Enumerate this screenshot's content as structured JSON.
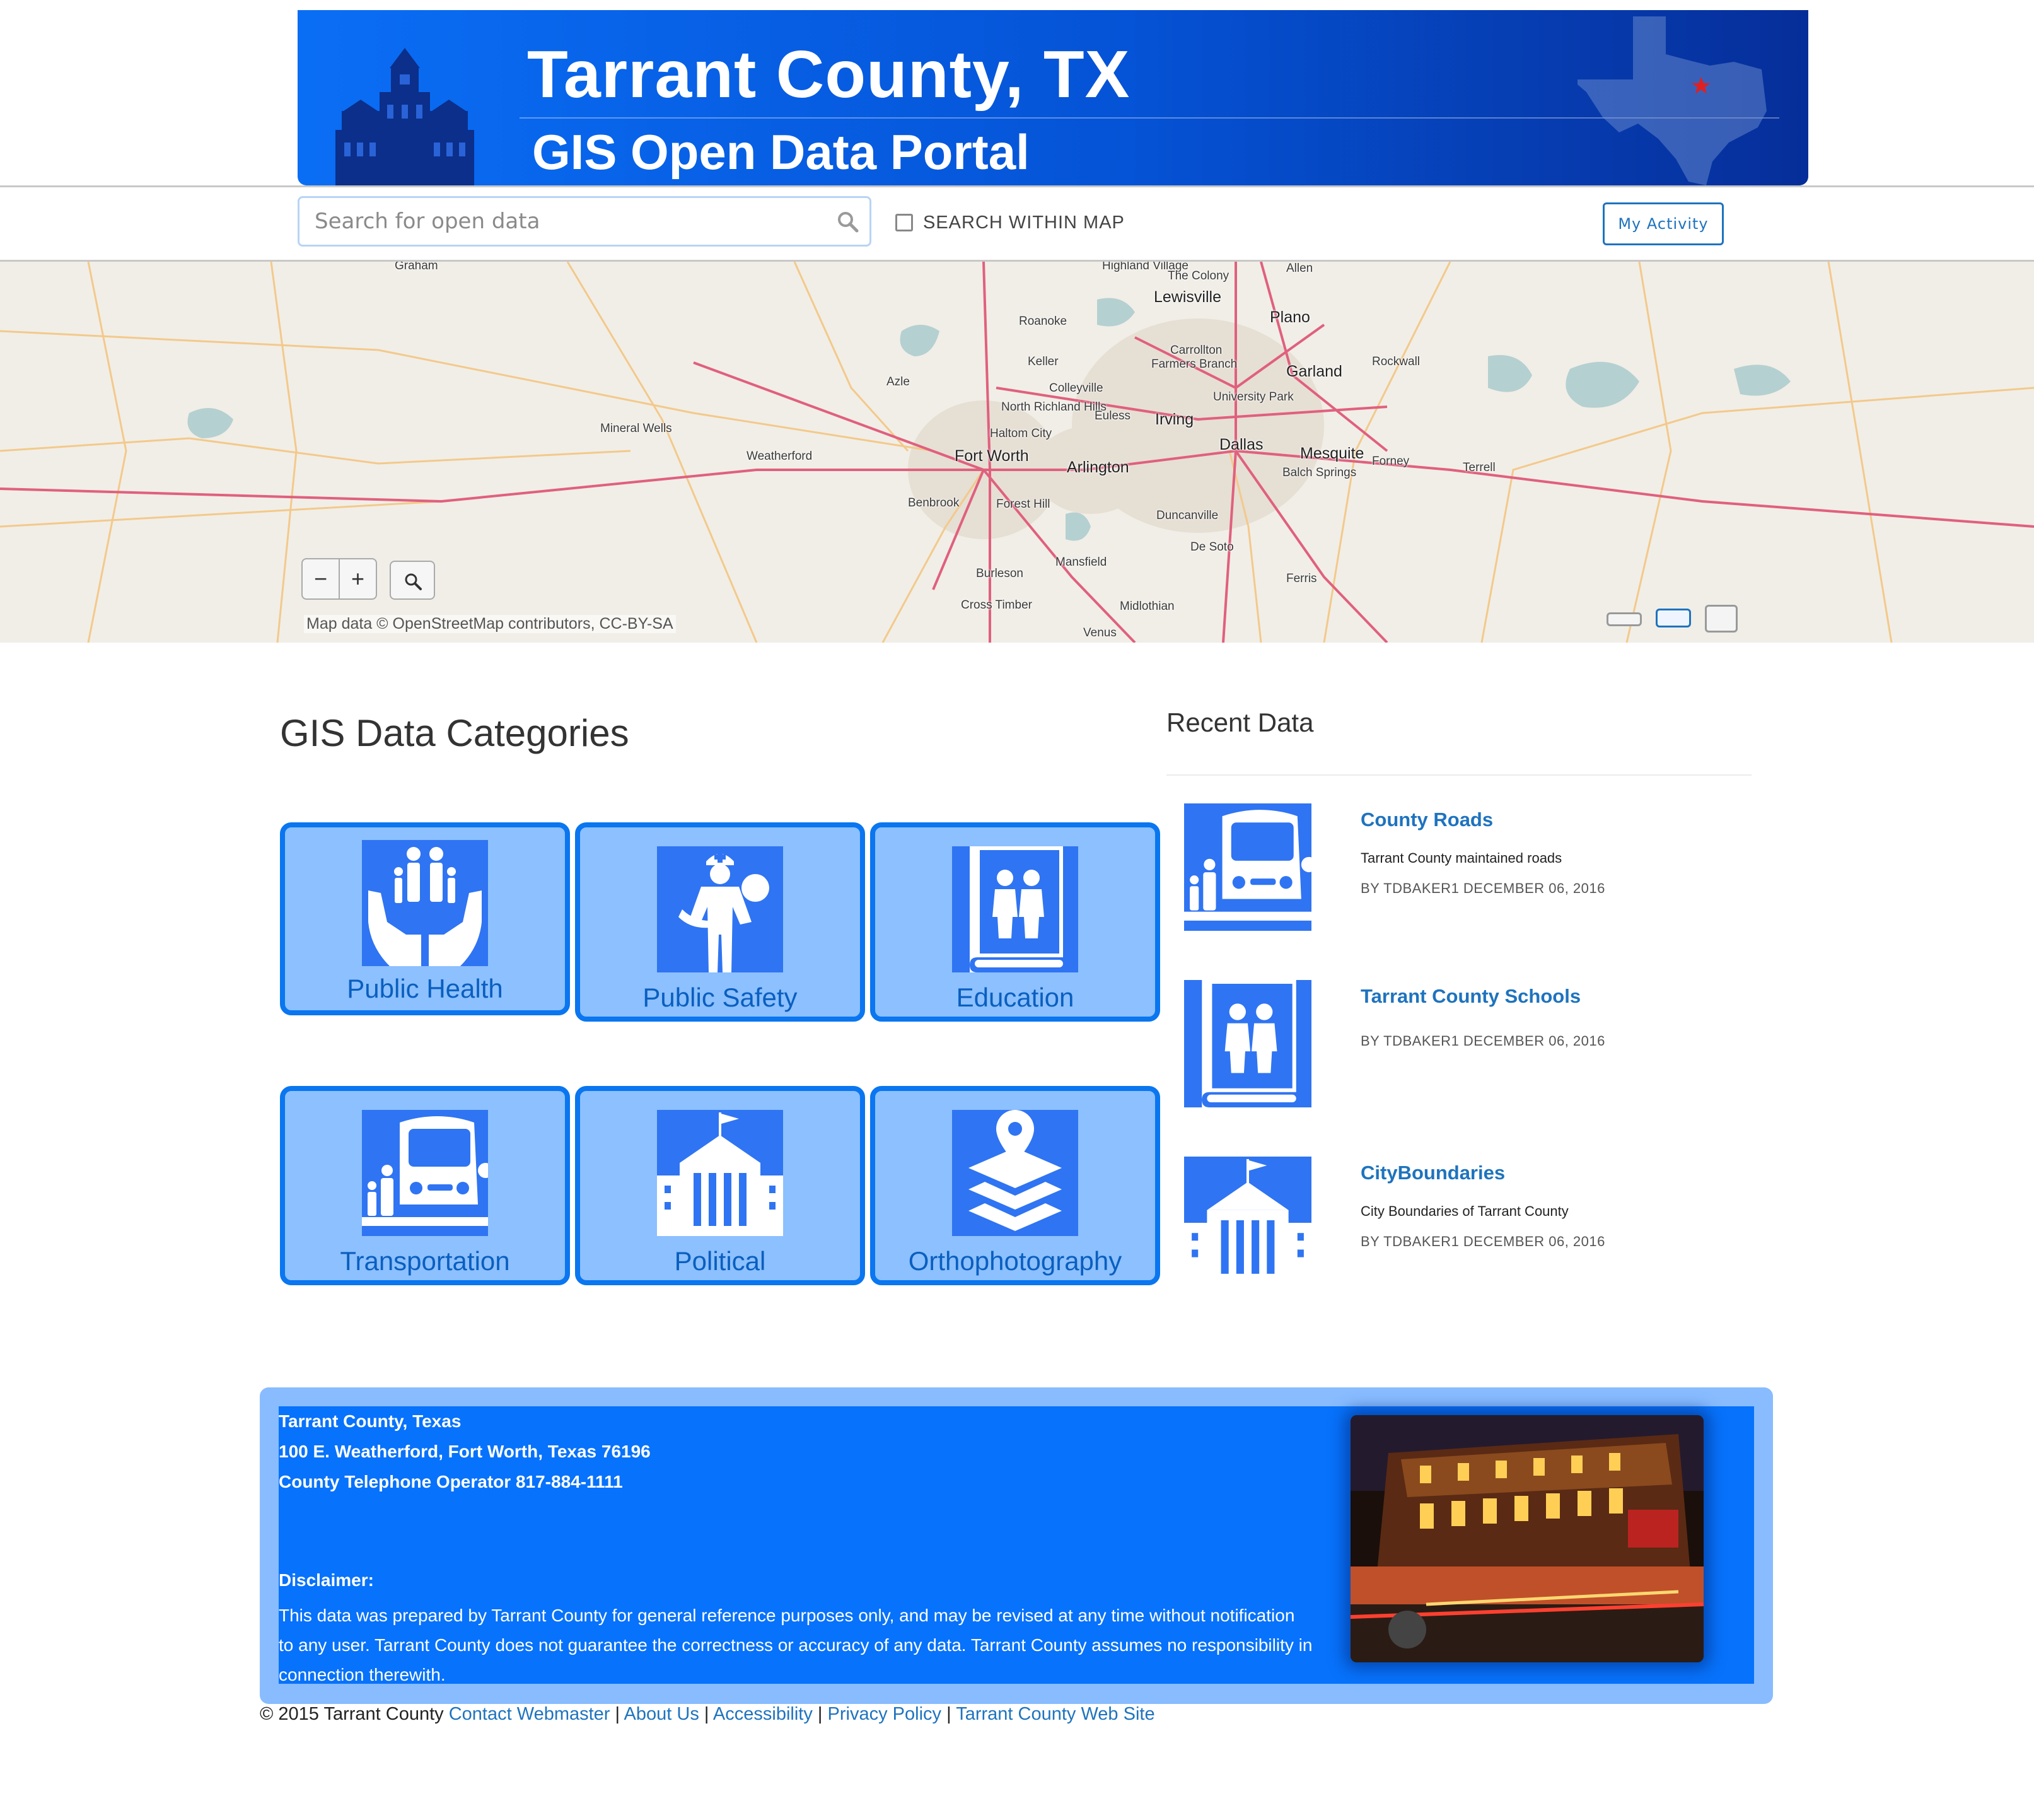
{
  "banner": {
    "title": "Tarrant County, TX",
    "subtitle": "GIS Open Data Portal"
  },
  "search": {
    "placeholder": "Search for open data",
    "within_map_label": "SEARCH WITHIN MAP",
    "activity_button": "My Activity"
  },
  "map": {
    "zoom_out": "−",
    "zoom_in": "+",
    "attribution": "Map data © OpenStreetMap contributors, CC-BY-SA",
    "towns": [
      "Graham",
      "Highland Village",
      "The Colony",
      "Allen",
      "Lewisville",
      "Roanoke",
      "Plano",
      "Keller",
      "Carrollton",
      "Farmers Branch",
      "Garland",
      "Rockwall",
      "Azle",
      "Colleyville",
      "University Park",
      "Mineral Wells",
      "North Richland Hills",
      "Euless",
      "Irving",
      "Haltom City",
      "Weatherford",
      "Fort Worth",
      "Arlington",
      "Dallas",
      "Mesquite",
      "Forney",
      "Terrell",
      "Balch Springs",
      "Benbrook",
      "Forest Hill",
      "Duncanville",
      "De Soto",
      "Mansfield",
      "Burleson",
      "Ferris",
      "Cross Timber",
      "Midlothian",
      "Venus"
    ]
  },
  "categories": {
    "title": "GIS Data Categories",
    "items": [
      {
        "label": "Public Health",
        "icon": "family-hands-icon"
      },
      {
        "label": "Public Safety",
        "icon": "rescuer-icon"
      },
      {
        "label": "Education",
        "icon": "school-book-icon"
      },
      {
        "label": "Transportation",
        "icon": "bus-stop-icon"
      },
      {
        "label": "Political",
        "icon": "government-building-icon"
      },
      {
        "label": "Orthophotography",
        "icon": "map-layers-icon"
      }
    ]
  },
  "recent": {
    "title": "Recent Data",
    "items": [
      {
        "title": "County Roads",
        "description": "Tarrant County maintained roads",
        "byline": "BY TDBAKER1 DECEMBER 06, 2016",
        "icon": "bus-stop-icon"
      },
      {
        "title": "Tarrant County Schools",
        "description": "",
        "byline": "BY TDBAKER1 DECEMBER 06, 2016",
        "icon": "school-book-icon"
      },
      {
        "title": "CityBoundaries",
        "description": "City Boundaries of Tarrant County",
        "byline": "BY TDBAKER1 DECEMBER 06, 2016",
        "icon": "government-building-icon"
      }
    ]
  },
  "footer": {
    "org": "Tarrant County, Texas",
    "address": "100 E. Weatherford, Fort Worth, Texas 76196",
    "phone": "County Telephone Operator 817-884-1111",
    "disclaimer_heading": "Disclaimer:",
    "disclaimer_text": "This data was prepared by Tarrant County for general reference purposes only, and may be revised at any time without notification to any user. Tarrant County does not guarantee the correctness or accuracy of any data. Tarrant County assumes no responsibility in connection therewith."
  },
  "bottom": {
    "copyright": "© 2015 Tarrant County",
    "links": [
      "Contact Webmaster",
      "About Us",
      "Accessibility",
      "Privacy Policy",
      "Tarrant County Web Site"
    ],
    "separator": "|"
  },
  "colors": {
    "brand_blue": "#0772fb",
    "tile_fill": "#8cc0ff",
    "link": "#1e73be",
    "icon_blue": "#2f74f2"
  }
}
